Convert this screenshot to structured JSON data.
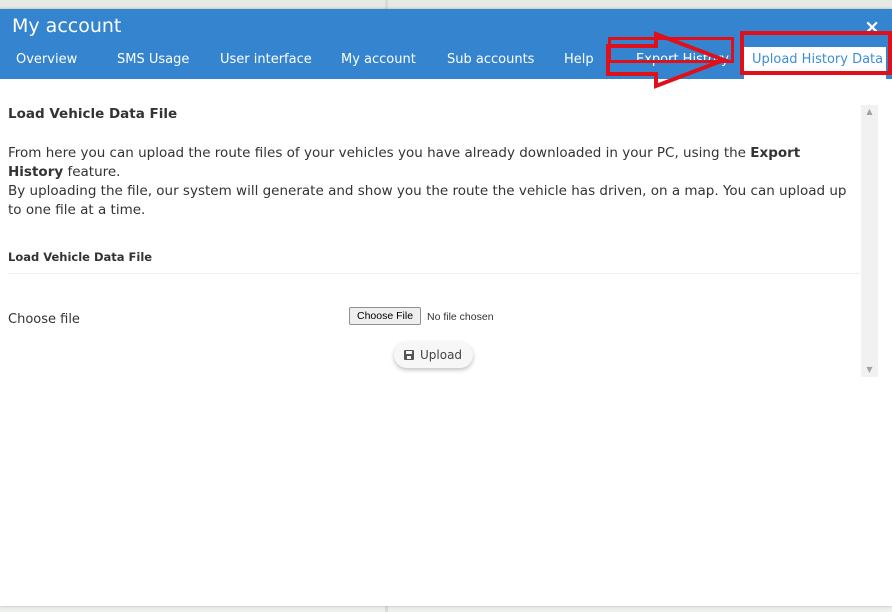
{
  "window": {
    "title": "My account",
    "close_glyph": "×"
  },
  "tabs": [
    {
      "label": "Overview"
    },
    {
      "label": "SMS Usage"
    },
    {
      "label": "User interface"
    },
    {
      "label": "My account"
    },
    {
      "label": "Sub accounts"
    },
    {
      "label": "Help"
    },
    {
      "label": "Export History"
    },
    {
      "label": "Upload History Data",
      "active": true
    }
  ],
  "annotation": {
    "highlight_color": "#e0101a",
    "arrow_icon": "right-arrow-icon"
  },
  "main": {
    "heading": "Load Vehicle Data File",
    "intro_part1": "From here you can upload the route files of your vehicles you have already downloaded in your PC, using the ",
    "intro_strong": "Export History",
    "intro_part2": " feature.",
    "intro_line2": "By uploading the file, our system will generate and show you the route the vehicle has driven, on a map. You can upload up to one file at a time.",
    "section_title": "Load Vehicle Data File",
    "choose_label": "Choose file",
    "file_button_label": "Choose File",
    "file_status": "No file chosen",
    "upload_label": "Upload",
    "upload_icon": "save-icon"
  },
  "colors": {
    "header_bg": "#3484d0",
    "active_tab_text": "#3b8ed6"
  }
}
